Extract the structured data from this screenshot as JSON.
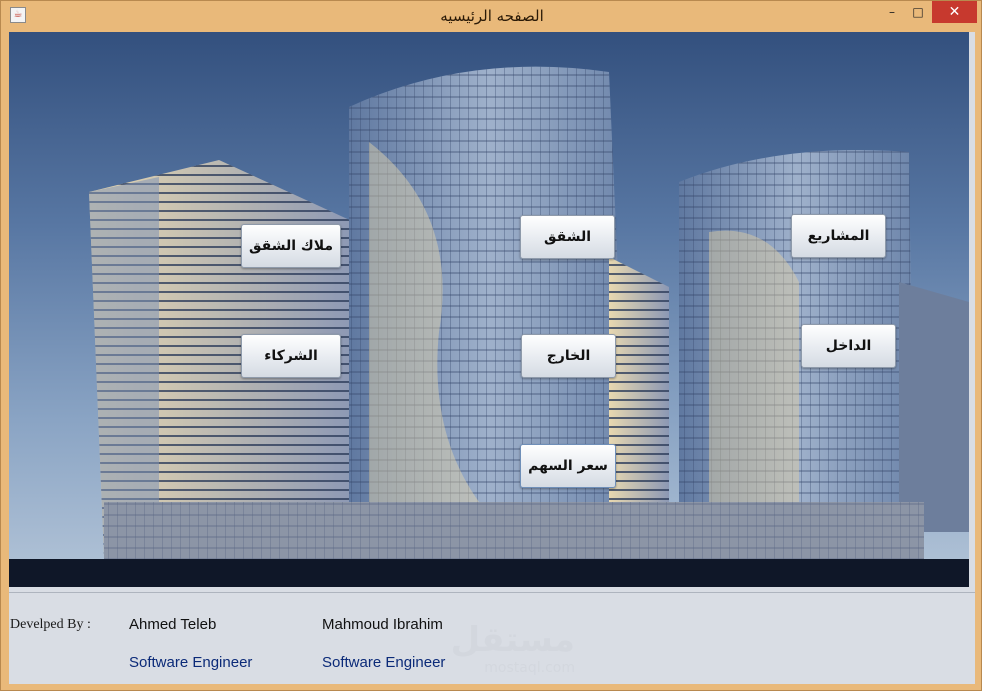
{
  "window": {
    "title": "الصفحه الرئيسيه",
    "icon": "java-cup-icon",
    "minimize": "–",
    "maximize": "□",
    "close": "✕"
  },
  "nav": {
    "apartment_owners": "ملاك الشقق",
    "apartments": "الشقق",
    "projects": "المشاريع",
    "partners": "الشركاء",
    "outside": "الخارج",
    "inside": "الداخل",
    "share_price": "سعر السهم"
  },
  "footer": {
    "developed_by_label": "Develped By :",
    "developers": [
      {
        "name": "Ahmed Teleb",
        "role": "Software Engineer"
      },
      {
        "name": "Mahmoud Ibrahim",
        "role": "Software Engineer"
      }
    ]
  },
  "watermark": {
    "text": "مستقل",
    "domain": "mostaql.com"
  },
  "colors": {
    "frame": "#e9b97a",
    "close_button": "#c7392e",
    "role_text": "#0b2a78",
    "sky": "#4a6a99"
  }
}
